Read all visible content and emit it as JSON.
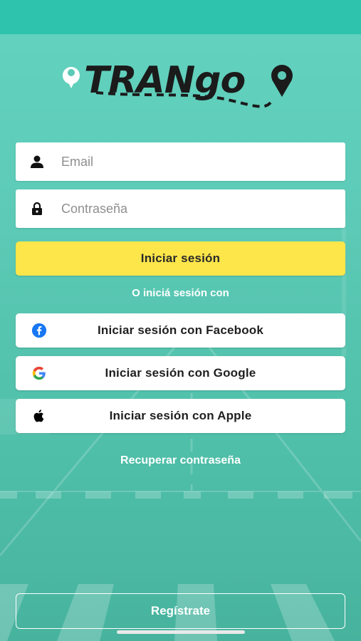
{
  "app": {
    "logo_text": "TRANgo"
  },
  "form": {
    "email_placeholder": "Email",
    "password_placeholder": "Contraseña",
    "login_label": "Iniciar sesión",
    "alt_login_text": "O iniciá sesión con"
  },
  "social": {
    "facebook_label": "Iniciar sesión con Facebook",
    "google_label": "Iniciar sesión con Google",
    "apple_label": "Iniciar sesión con Apple"
  },
  "links": {
    "recover_label": "Recuperar contraseña",
    "register_label": "Regístrate"
  },
  "colors": {
    "accent_teal": "#2ec3ad",
    "login_yellow": "#fde64a",
    "facebook_blue": "#1877f2"
  }
}
